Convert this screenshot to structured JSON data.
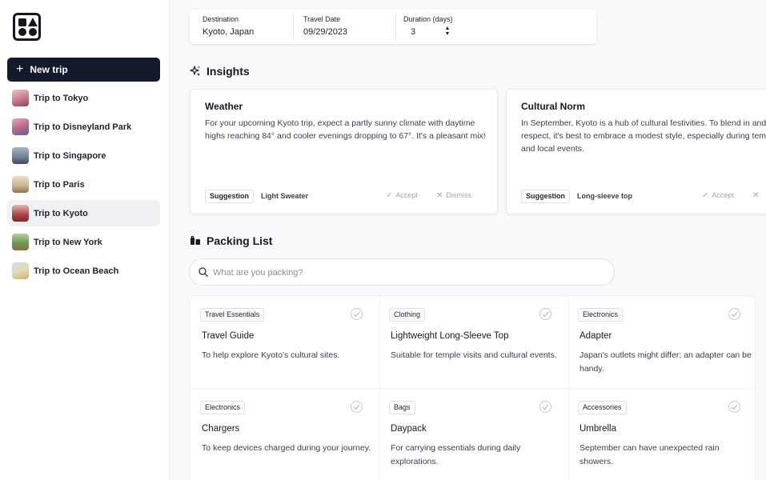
{
  "sidebar": {
    "new_trip_label": "New trip",
    "trips": [
      {
        "label": "Trip to Tokyo",
        "thumb_color": "#c97a8a",
        "active": false
      },
      {
        "label": "Trip to Disneyland Park",
        "thumb_color": "#b86a8c",
        "active": false
      },
      {
        "label": "Trip to Singapore",
        "thumb_color": "#6f7f95",
        "active": false
      },
      {
        "label": "Trip to Paris",
        "thumb_color": "#c9b48a",
        "active": false
      },
      {
        "label": "Trip to Kyoto",
        "thumb_color": "#b7444a",
        "active": true
      },
      {
        "label": "Trip to New York",
        "thumb_color": "#6f9a55",
        "active": false
      },
      {
        "label": "Trip to Ocean Beach",
        "thumb_color": "#c9b27a",
        "active": false
      }
    ]
  },
  "filters": {
    "destination_label": "Destination",
    "destination_value": "Kyoto, Japan",
    "date_label": "Travel Date",
    "date_value": "09/29/2023",
    "duration_label": "Duration (days)",
    "duration_value": "3"
  },
  "insights": {
    "title": "Insights",
    "cards": [
      {
        "title": "Weather",
        "body": "For your upcoming Kyoto trip, expect a partly sunny climate with daytime highs reaching 84° and cooler evenings dropping to 67°. It's a pleasant mix!",
        "tag": "Suggestion",
        "tag_value": "Light Sweater",
        "accept": "Accept",
        "dismiss": "Dismiss"
      },
      {
        "title": "Cultural Norm",
        "body": "In September, Kyoto is a hub of cultural festivities. To blend in and show respect, it's best to embrace a modest style, especially during temple visits and local events.",
        "tag": "Suggestion",
        "tag_value": "Long-sleeve top",
        "accept": "Accept",
        "dismiss": ""
      }
    ]
  },
  "packing": {
    "title": "Packing List",
    "search_placeholder": "What are you packing?",
    "items": [
      {
        "category": "Travel Essentials",
        "title": "Travel Guide",
        "desc": "To help explore Kyoto's cultural sites."
      },
      {
        "category": "Clothing",
        "title": "Lightweight Long-Sleeve Top",
        "desc": "Suitable for temple visits and cultural events."
      },
      {
        "category": "Electronics",
        "title": "Adapter",
        "desc": "Japan's outlets might differ; an adapter can be handy."
      },
      {
        "category": "Electronics",
        "title": "Chargers",
        "desc": "To keep devices charged during your journey."
      },
      {
        "category": "Bags",
        "title": "Daypack",
        "desc": "For carrying essentials during daily explorations."
      },
      {
        "category": "Accessories",
        "title": "Umbrella",
        "desc": "September can have unexpected rain showers."
      }
    ]
  },
  "colors": {
    "primary_button": "#161b2b",
    "active_item_bg": "#f0f1f4",
    "muted_text": "#a2a7b2"
  }
}
